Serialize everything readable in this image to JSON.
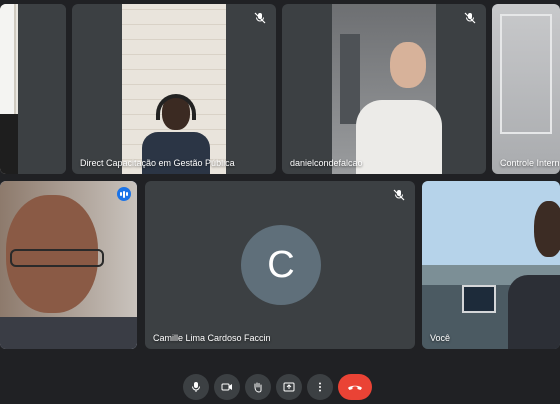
{
  "participants": [
    {
      "id": "p-left-cropped",
      "name": "",
      "muted": false
    },
    {
      "id": "p-direct",
      "name": "Direct Capacitação em Gestão Pública",
      "muted": true
    },
    {
      "id": "p-daniel",
      "name": "danielcondefalcao",
      "muted": true
    },
    {
      "id": "p-controle",
      "name": "Controle Intern",
      "muted": false
    },
    {
      "id": "p-speaker",
      "name": "",
      "speaking": true
    },
    {
      "id": "p-camille",
      "name": "Camille Lima Cardoso Faccin",
      "avatar_letter": "C",
      "muted": true
    },
    {
      "id": "p-self",
      "name": "Você",
      "muted": false
    }
  ],
  "controls": [
    {
      "id": "mic",
      "icon": "microphone-icon"
    },
    {
      "id": "camera",
      "icon": "camera-icon"
    },
    {
      "id": "raise-hand",
      "icon": "hand-icon"
    },
    {
      "id": "present",
      "icon": "present-screen-icon"
    },
    {
      "id": "more",
      "icon": "more-vert-icon"
    },
    {
      "id": "leave",
      "icon": "end-call-icon"
    }
  ],
  "colors": {
    "background": "#202124",
    "tile": "#3c4043",
    "active_border": "#8ab4f8",
    "end_call": "#ea4335",
    "avatar": "#5f6f7a"
  }
}
